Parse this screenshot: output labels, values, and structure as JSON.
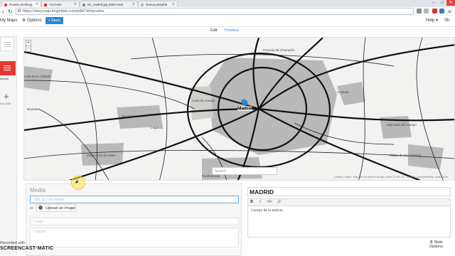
{
  "browser": {
    "tabs": [
      {
        "label": "Prueba (Editing)"
      },
      {
        "label": "YouTube"
      },
      {
        "label": "02_madrid.jpg (600×445)"
      },
      {
        "label": "Nueva pestaña"
      }
    ],
    "url": "https://storymap.knightlab.com/edit/?id=prueba",
    "window_controls": [
      "–",
      "□",
      "✕"
    ]
  },
  "toolbar": {
    "my_maps": "My Maps",
    "options": "Options",
    "save": "Save",
    "help": "Help ▾",
    "share": "Sh"
  },
  "view_tabs": {
    "edit": "Edit",
    "preview": "Preview"
  },
  "slides": {
    "slide_label": "Madrid",
    "add_label": "Add Slide"
  },
  "map": {
    "zoom_in": "+",
    "zoom_out": "−",
    "center_label": "Madrid",
    "places": [
      "Pozuelo de Chamartín",
      "Lista de la Cañada",
      "Coslada",
      "Brunete",
      "Casa de Campo",
      "Alcorcón",
      "Leganés",
      "Mejorada del Campo",
      "Villaviciosa de Odón",
      "Villalba de San Antonio",
      "Fuenlabrada"
    ],
    "search_placeholder": "Search",
    "attribution": "Leaflet | Leaflet · Map tiles by Stamen Design, under CC BY 3.0 · Data by OpenStreetMap, under ODbL"
  },
  "media": {
    "heading": "Media",
    "url_placeholder": "URL to your media",
    "or": "or",
    "upload": "Upload an Image",
    "credit_placeholder": "Credit",
    "caption_placeholder": "Caption"
  },
  "text": {
    "headline": "MADRID",
    "rte_buttons": [
      "B",
      "I",
      "</>",
      "🔗"
    ],
    "body": "Cuerpo de la noticia"
  },
  "slide_options": "Slide Options",
  "watermark": {
    "line1": "Recorded with",
    "line2": "SCREENCAST·MATIC"
  },
  "colors": {
    "accent": "#2d86d1",
    "slide_active": "#e03b2e"
  }
}
